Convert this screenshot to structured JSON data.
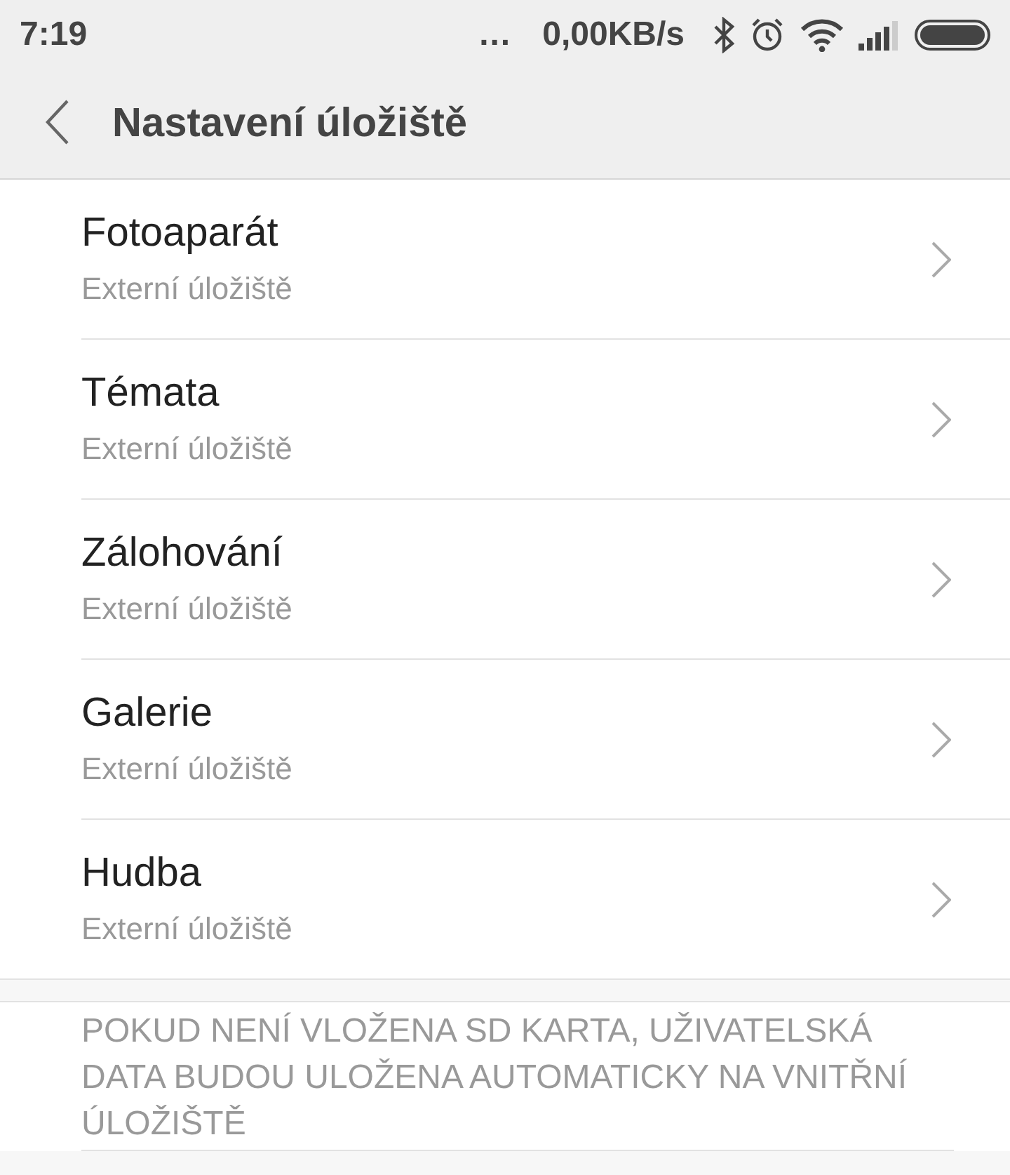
{
  "status_bar": {
    "time": "7:19",
    "more": "...",
    "speed": "0,00KB/s"
  },
  "header": {
    "title": "Nastavení úložiště"
  },
  "items": [
    {
      "title": "Fotoaparát",
      "subtitle": "Externí úložiště"
    },
    {
      "title": "Témata",
      "subtitle": "Externí úložiště"
    },
    {
      "title": "Zálohování",
      "subtitle": "Externí úložiště"
    },
    {
      "title": "Galerie",
      "subtitle": "Externí úložiště"
    },
    {
      "title": "Hudba",
      "subtitle": "Externí úložiště"
    }
  ],
  "note": "POKUD NENÍ VLOŽENA SD KARTA, UŽIVATELSKÁ DATA BUDOU ULOŽENA AUTOMATICKY NA VNITŘNÍ ÚLOŽIŠTĚ"
}
